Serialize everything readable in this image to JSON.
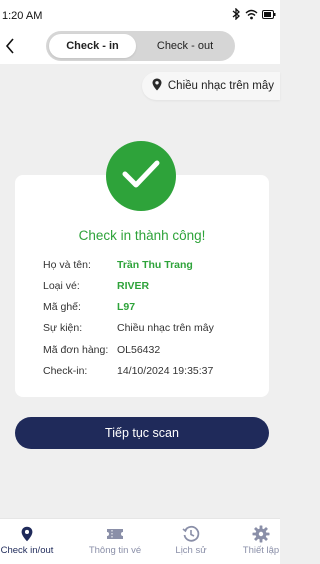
{
  "status_bar": {
    "time": "1:20 AM"
  },
  "header": {
    "tabs": [
      {
        "label": "Check - in",
        "active": true
      },
      {
        "label": "Check - out",
        "active": false
      }
    ]
  },
  "event_chip": {
    "label": "Chiều nhạc trên mây",
    "icon": "location-pin-icon"
  },
  "result": {
    "title": "Check in thành công!",
    "icon": "checkmark-icon",
    "rows": [
      {
        "label": "Họ và tên:",
        "value": "Trần Thu Trang",
        "highlight": true
      },
      {
        "label": "Loại vé:",
        "value": "RIVER",
        "highlight": true
      },
      {
        "label": "Mã ghế:",
        "value": "L97",
        "highlight": true
      },
      {
        "label": "Sự kiện:",
        "value": "Chiều nhạc trên mây",
        "highlight": false
      },
      {
        "label": "Mã đơn hàng:",
        "value": "OL56432",
        "highlight": false
      },
      {
        "label": "Check-in:",
        "value": "14/10/2024 19:35:37",
        "highlight": false
      }
    ]
  },
  "cta": {
    "label": "Tiếp tục scan"
  },
  "bottom_nav": {
    "items": [
      {
        "label": "Check in/out",
        "icon": "location-pin-icon",
        "active": true
      },
      {
        "label": "Thông tin vé",
        "icon": "ticket-icon",
        "active": false
      },
      {
        "label": "Lịch sử",
        "icon": "history-icon",
        "active": false
      },
      {
        "label": "Thiết lập",
        "icon": "gear-icon",
        "active": false
      }
    ]
  },
  "colors": {
    "accent": "#2ea33a",
    "primary": "#1f2a5a"
  }
}
